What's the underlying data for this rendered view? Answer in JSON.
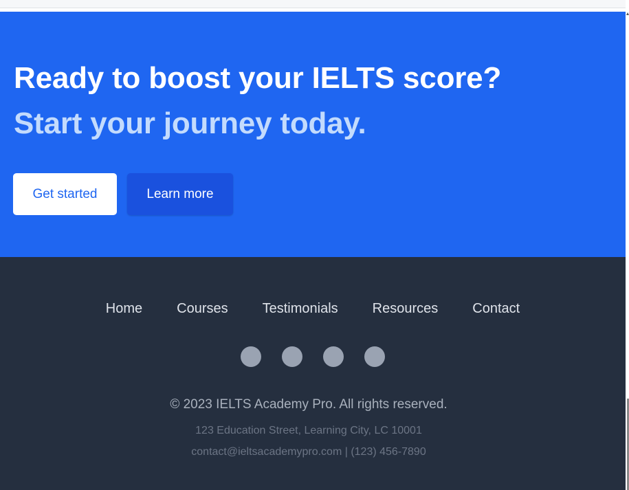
{
  "hero": {
    "title": "Ready to boost your IELTS score?",
    "subtitle": "Start your journey today.",
    "primary_button": "Get started",
    "secondary_button": "Learn more",
    "background_color": "#1f66f1",
    "subtitle_color": "#c3dbfd"
  },
  "footer": {
    "nav": [
      {
        "label": "Home"
      },
      {
        "label": "Courses"
      },
      {
        "label": "Testimonials"
      },
      {
        "label": "Resources"
      },
      {
        "label": "Contact"
      }
    ],
    "social_icons": [
      "social-icon",
      "social-icon",
      "social-icon",
      "social-icon"
    ],
    "copyright": "© 2023 IELTS Academy Pro. All rights reserved.",
    "address": "123 Education Street, Learning City, LC 10001",
    "contact": "contact@ieltsacademypro.com | (123) 456-7890",
    "background_color": "#252f3f"
  }
}
